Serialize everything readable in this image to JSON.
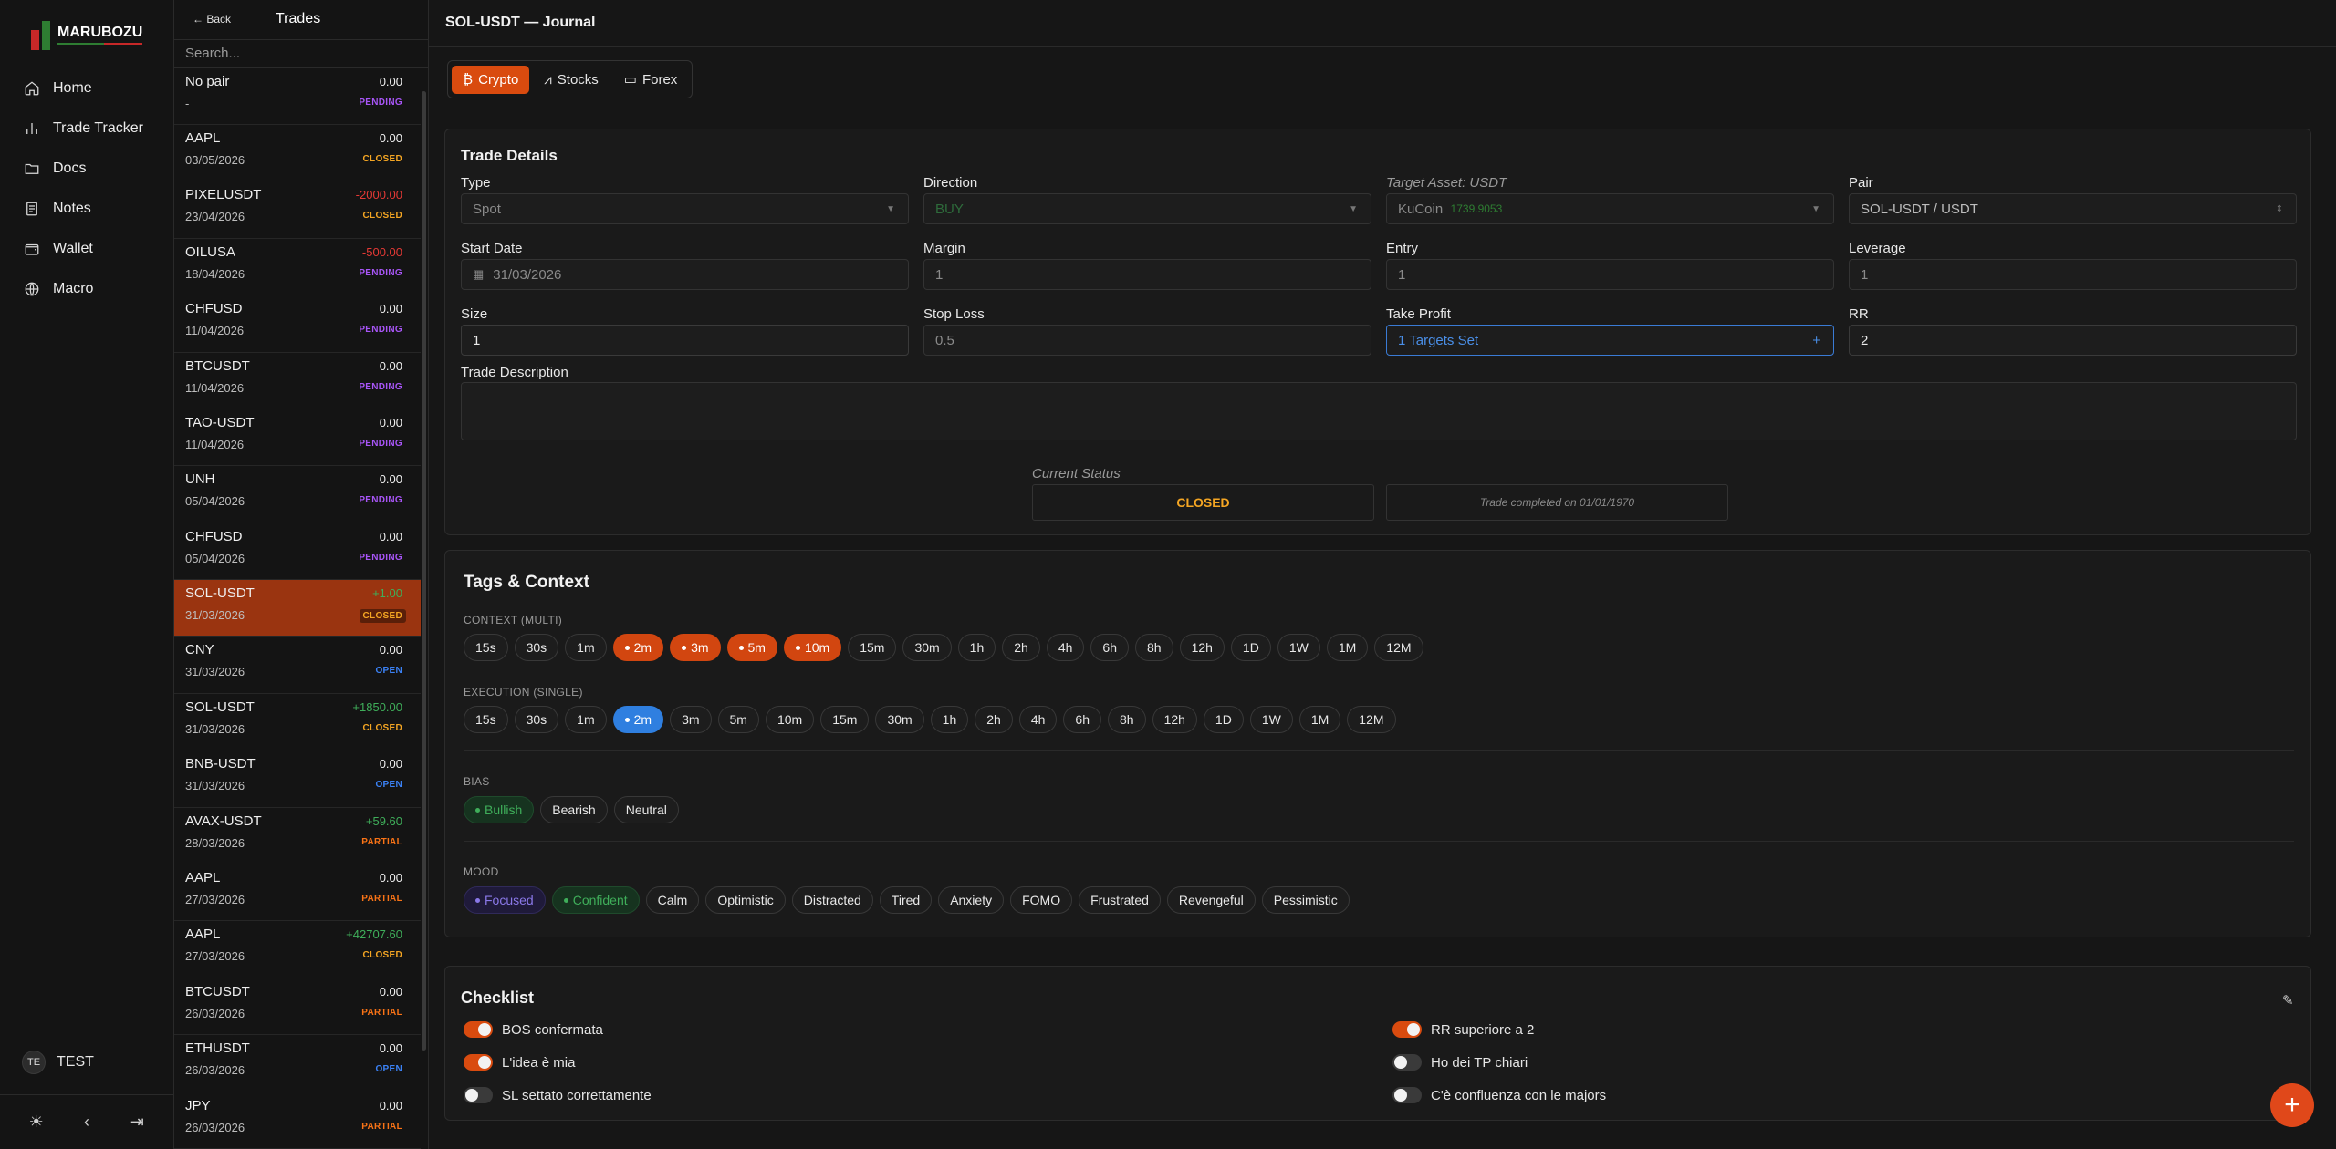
{
  "brand": {
    "name": "MARUBOZU"
  },
  "nav": {
    "items": [
      {
        "label": "Home",
        "icon": "home-icon"
      },
      {
        "label": "Trade Tracker",
        "icon": "chart-bar-icon"
      },
      {
        "label": "Docs",
        "icon": "folder-icon"
      },
      {
        "label": "Notes",
        "icon": "notes-icon"
      },
      {
        "label": "Wallet",
        "icon": "wallet-icon"
      },
      {
        "label": "Macro",
        "icon": "globe-icon"
      }
    ],
    "user": {
      "initials": "TE",
      "name": "TEST"
    }
  },
  "trades_panel": {
    "back_label": "← Back",
    "title": "Trades",
    "search_placeholder": "Search...",
    "rows": [
      {
        "pair": "No pair",
        "date": "-",
        "pnl": "0.00",
        "status": "PENDING"
      },
      {
        "pair": "AAPL",
        "date": "03/05/2026",
        "pnl": "0.00",
        "status": "CLOSED"
      },
      {
        "pair": "PIXELUSDT",
        "date": "23/04/2026",
        "pnl": "-2000.00",
        "status": "CLOSED"
      },
      {
        "pair": "OILUSA",
        "date": "18/04/2026",
        "pnl": "-500.00",
        "status": "PENDING"
      },
      {
        "pair": "CHFUSD",
        "date": "11/04/2026",
        "pnl": "0.00",
        "status": "PENDING"
      },
      {
        "pair": "BTCUSDT",
        "date": "11/04/2026",
        "pnl": "0.00",
        "status": "PENDING"
      },
      {
        "pair": "TAO-USDT",
        "date": "11/04/2026",
        "pnl": "0.00",
        "status": "PENDING"
      },
      {
        "pair": "UNH",
        "date": "05/04/2026",
        "pnl": "0.00",
        "status": "PENDING"
      },
      {
        "pair": "CHFUSD",
        "date": "05/04/2026",
        "pnl": "0.00",
        "status": "PENDING"
      },
      {
        "pair": "SOL-USDT",
        "date": "31/03/2026",
        "pnl": "+1.00",
        "status": "CLOSED"
      },
      {
        "pair": "CNY",
        "date": "31/03/2026",
        "pnl": "0.00",
        "status": "OPEN"
      },
      {
        "pair": "SOL-USDT",
        "date": "31/03/2026",
        "pnl": "+1850.00",
        "status": "CLOSED"
      },
      {
        "pair": "BNB-USDT",
        "date": "31/03/2026",
        "pnl": "0.00",
        "status": "OPEN"
      },
      {
        "pair": "AVAX-USDT",
        "date": "28/03/2026",
        "pnl": "+59.60",
        "status": "PARTIAL"
      },
      {
        "pair": "AAPL",
        "date": "27/03/2026",
        "pnl": "0.00",
        "status": "PARTIAL"
      },
      {
        "pair": "AAPL",
        "date": "27/03/2026",
        "pnl": "+42707.60",
        "status": "CLOSED"
      },
      {
        "pair": "BTCUSDT",
        "date": "26/03/2026",
        "pnl": "0.00",
        "status": "PARTIAL"
      },
      {
        "pair": "ETHUSDT",
        "date": "26/03/2026",
        "pnl": "0.00",
        "status": "OPEN"
      },
      {
        "pair": "JPY",
        "date": "26/03/2026",
        "pnl": "0.00",
        "status": "PARTIAL"
      }
    ]
  },
  "colors": {
    "accent": "#d94b0f",
    "pending": "#a855f7",
    "closed": "#f5a623",
    "open": "#3b82f6",
    "partial": "#f97316",
    "positive": "#3fae5a",
    "negative": "#e53935"
  },
  "main": {
    "title": "SOL-USDT — Journal",
    "asset_tabs": [
      "Crypto",
      "Stocks",
      "Forex"
    ],
    "details": {
      "title": "Trade Details",
      "type_label": "Type",
      "type_value": "Spot",
      "direction_label": "Direction",
      "direction_value": "BUY",
      "target_label": "Target Asset: USDT",
      "exchange_value": "KuCoin",
      "exchange_balance": "1739.9053",
      "pair_label": "Pair",
      "pair_value": "SOL-USDT / USDT",
      "start_label": "Start Date",
      "start_value": "31/03/2026",
      "margin_label": "Margin",
      "margin_value": "1",
      "entry_label": "Entry",
      "entry_value": "1",
      "leverage_label": "Leverage",
      "leverage_value": "1",
      "size_label": "Size",
      "size_value": "1",
      "sl_label": "Stop Loss",
      "sl_value": "0.5",
      "tp_label": "Take Profit",
      "tp_value": "1 Targets Set",
      "rr_label": "RR",
      "rr_value": "2",
      "desc_label": "Trade Description",
      "status_label": "Current Status",
      "status_value": "CLOSED",
      "completed_text": "Trade completed on 01/01/1970"
    },
    "tags": {
      "title": "Tags & Context",
      "context_label": "CONTEXT (MULTI)",
      "context": [
        "15s",
        "30s",
        "1m",
        "2m",
        "3m",
        "5m",
        "10m",
        "15m",
        "30m",
        "1h",
        "2h",
        "4h",
        "6h",
        "8h",
        "12h",
        "1D",
        "1W",
        "1M",
        "12M"
      ],
      "context_selected": [
        "2m",
        "3m",
        "5m",
        "10m"
      ],
      "execution_label": "EXECUTION (SINGLE)",
      "execution": [
        "15s",
        "30s",
        "1m",
        "2m",
        "3m",
        "5m",
        "10m",
        "15m",
        "30m",
        "1h",
        "2h",
        "4h",
        "6h",
        "8h",
        "12h",
        "1D",
        "1W",
        "1M",
        "12M"
      ],
      "execution_selected": "2m",
      "bias_label": "BIAS",
      "bias": [
        "Bullish",
        "Bearish",
        "Neutral"
      ],
      "mood_label": "MOOD",
      "mood": [
        "Focused",
        "Confident",
        "Calm",
        "Optimistic",
        "Distracted",
        "Tired",
        "Anxiety",
        "FOMO",
        "Frustrated",
        "Revengeful",
        "Pessimistic"
      ]
    },
    "checklist": {
      "title": "Checklist",
      "left": [
        {
          "label": "BOS confermata",
          "on": true
        },
        {
          "label": "L'idea è mia",
          "on": true
        },
        {
          "label": "SL settato correttamente",
          "on": false
        }
      ],
      "right": [
        {
          "label": "RR superiore a 2",
          "on": true
        },
        {
          "label": "Ho dei TP chiari",
          "on": false
        },
        {
          "label": "C'è confluenza con le majors",
          "on": false
        }
      ]
    }
  }
}
